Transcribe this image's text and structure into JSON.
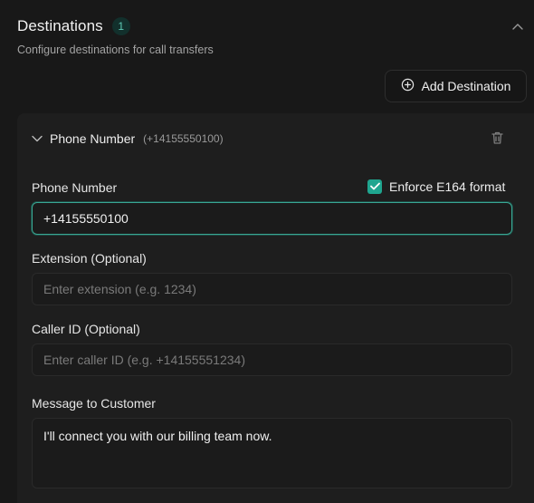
{
  "section": {
    "title": "Destinations",
    "count": "1",
    "subtitle": "Configure destinations for call transfers"
  },
  "add_destination_label": "Add Destination",
  "destination": {
    "title": "Phone Number",
    "number_preview": "(+14155550100)",
    "phone_label": "Phone Number",
    "enforce_e164_label": "Enforce E164 format",
    "enforce_e164_checked": true,
    "phone_value": "+14155550100",
    "extension_label": "Extension (Optional)",
    "extension_placeholder": "Enter extension (e.g. 1234)",
    "caller_id_label": "Caller ID (Optional)",
    "caller_id_placeholder": "Enter caller ID (e.g. +14155551234)",
    "message_label": "Message to Customer",
    "message_value": "I'll connect you with our billing team now."
  },
  "colors": {
    "accent": "#1fa58f",
    "background": "#181818",
    "card": "#1e1e1e"
  },
  "icons": {
    "collapse": "chevron-up-icon",
    "add": "plus-circle-icon",
    "expand": "chevron-down-icon",
    "delete": "trash-icon",
    "check": "check-icon"
  }
}
